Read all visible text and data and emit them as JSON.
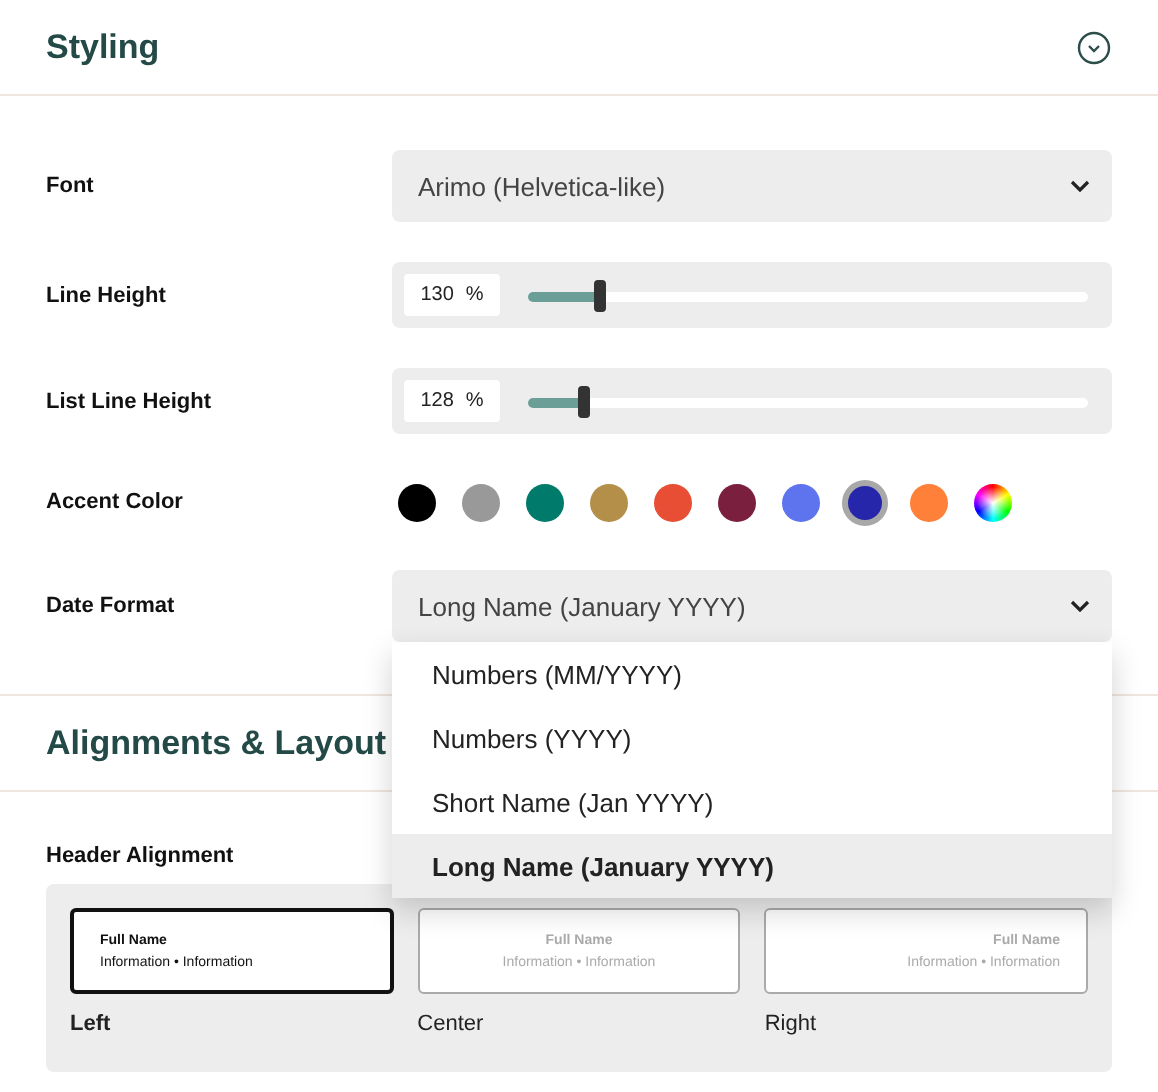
{
  "section": {
    "title": "Styling",
    "expanded": true
  },
  "settings": [
    {
      "kind": "select",
      "label": "Font",
      "value": "Arimo (Helvetica-like)"
    },
    {
      "kind": "slider",
      "label": "Line Height",
      "reading": "130",
      "unit": "%",
      "level": 0.13
    },
    {
      "kind": "slider",
      "label": "List Line Height",
      "reading": "128",
      "unit": "%",
      "level": 0.1
    },
    {
      "kind": "colors",
      "label": "Accent Color",
      "swatches": [
        {
          "kind": "color",
          "color": "#000000",
          "selected": false
        },
        {
          "kind": "color",
          "color": "#999999",
          "selected": false
        },
        {
          "kind": "color",
          "color": "#007a6a",
          "selected": false
        },
        {
          "kind": "color",
          "color": "#b38f4a",
          "selected": false
        },
        {
          "kind": "color",
          "color": "#e84e33",
          "selected": false
        },
        {
          "kind": "color",
          "color": "#7a1f3d",
          "selected": false
        },
        {
          "kind": "color",
          "color": "#5e74ee",
          "selected": false
        },
        {
          "kind": "color",
          "color": "#2626aa",
          "selected": true
        },
        {
          "kind": "color",
          "color": "#ff8038",
          "selected": false
        },
        {
          "kind": "custom",
          "selected": false
        }
      ]
    },
    {
      "kind": "select",
      "label": "Date Format",
      "value": "Long Name (January YYYY)",
      "open": true,
      "options": [
        {
          "label": "Numbers (MM/YYYY)",
          "selected": false
        },
        {
          "label": "Numbers (YYYY)",
          "selected": false
        },
        {
          "label": "Short Name (Jan YYYY)",
          "selected": false
        },
        {
          "label": "Long Name (January YYYY)",
          "selected": true
        }
      ]
    }
  ],
  "section2": {
    "title": "Alignments & Layout"
  },
  "header_alignment": {
    "label": "Header Alignment",
    "options": [
      {
        "label": "Left",
        "kind": "left",
        "preview_name": "Full Name",
        "preview_info": "Information • Information",
        "selected": true
      },
      {
        "label": "Center",
        "kind": "center",
        "preview_name": "Full Name",
        "preview_info": "Information • Information",
        "selected": false
      },
      {
        "label": "Right",
        "kind": "right",
        "preview_name": "Full Name",
        "preview_info": "Information • Information",
        "selected": false
      }
    ]
  }
}
